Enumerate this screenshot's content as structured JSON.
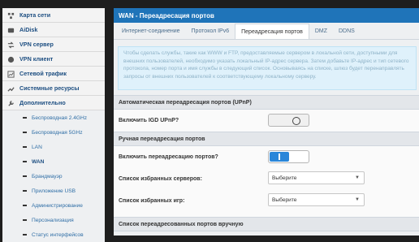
{
  "sidebar": {
    "items": [
      {
        "label": "Карта сети",
        "icon": "network-map-icon"
      },
      {
        "label": "AiDisk",
        "icon": "aidisk-icon"
      },
      {
        "label": "VPN сервер",
        "icon": "vpn-server-icon"
      },
      {
        "label": "VPN клиент",
        "icon": "vpn-client-icon"
      },
      {
        "label": "Сетевой трафик",
        "icon": "traffic-icon"
      },
      {
        "label": "Системные ресурсы",
        "icon": "resources-icon"
      },
      {
        "label": "Дополнительно",
        "icon": "wrench-icon"
      }
    ],
    "subitems": [
      {
        "label": "Беспроводная 2.4GHz"
      },
      {
        "label": "Беспроводная 5GHz"
      },
      {
        "label": "LAN"
      },
      {
        "label": "WAN",
        "active": true
      },
      {
        "label": "Брандмауэр"
      },
      {
        "label": "Приложение USB"
      },
      {
        "label": "Администрирование"
      },
      {
        "label": "Персонализация"
      },
      {
        "label": "Статус интерфейсов"
      }
    ]
  },
  "header": {
    "title": "WAN - Переадресация портов"
  },
  "tabs": [
    {
      "label": "Интернет-соединение"
    },
    {
      "label": "Протокол IPv6"
    },
    {
      "label": "Переадресация портов",
      "active": true
    },
    {
      "label": "DMZ"
    },
    {
      "label": "DDNS"
    }
  ],
  "info_text": "Чтобы сделать службы, такие как WWW и FTP, предоставляемые сервером в локальной сети, доступными для внешних пользователей, необходимо указать локальный IP-адрес сервера. Затем добавьте IP-адрес и тип сетевого протокола, номер порта и имя службы в следующий список. Основываясь на списке, шлюз будет перенаправлять запросы от внешних пользователей к соответствующему локальному серверу.",
  "sections": {
    "upnp": {
      "title": "Автоматическая переадресация портов (UPnP)",
      "enable_label": "Включить IGD UPnP?"
    },
    "manual": {
      "title": "Ручная переадресация портов",
      "enable_label": "Включить переадресацию портов?",
      "servers_label": "Список избранных серверов:",
      "servers_value": "Выберите",
      "games_label": "Список избранных игр:",
      "games_value": "Выберите"
    },
    "list": {
      "title": "Список переадресованных портов вручную"
    }
  },
  "colors": {
    "accent": "#1f74b9",
    "toggle_on": "#2a86d9"
  }
}
